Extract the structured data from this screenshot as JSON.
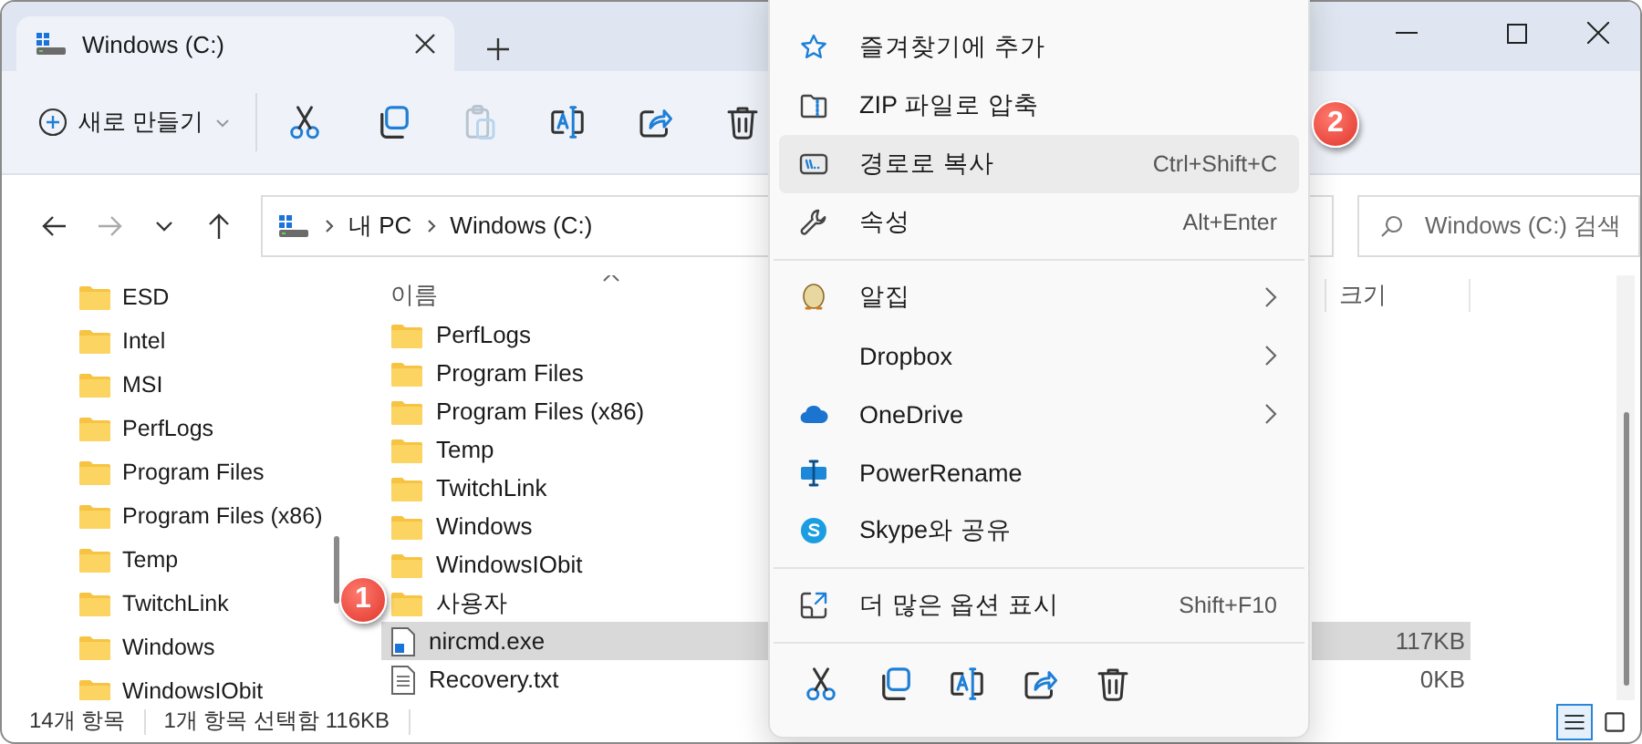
{
  "window": {
    "tab_title": "Windows (C:)"
  },
  "toolbar": {
    "new_button": "새로 만들기",
    "actions": [
      {
        "kind": "cut",
        "disabled": false
      },
      {
        "kind": "copy",
        "disabled": false
      },
      {
        "kind": "paste",
        "disabled": true
      },
      {
        "kind": "rename",
        "disabled": false
      },
      {
        "kind": "share",
        "disabled": false
      },
      {
        "kind": "delete",
        "disabled": false
      }
    ]
  },
  "address_bar": {
    "path": [
      "내 PC",
      "Windows (C:)"
    ]
  },
  "search": {
    "placeholder": "Windows (C:) 검색"
  },
  "nav_pane": {
    "items": [
      "ESD",
      "Intel",
      "MSI",
      "PerfLogs",
      "Program Files",
      "Program Files (x86)",
      "Temp",
      "TwitchLink",
      "Windows",
      "WindowsIObit"
    ]
  },
  "file_list": {
    "columns": [
      "이름",
      "크기"
    ],
    "rows": [
      {
        "name": "PerfLogs",
        "kind": "folder",
        "selected": false
      },
      {
        "name": "Program Files",
        "kind": "folder",
        "selected": false
      },
      {
        "name": "Program Files (x86)",
        "kind": "folder",
        "selected": false
      },
      {
        "name": "Temp",
        "kind": "folder",
        "selected": false
      },
      {
        "name": "TwitchLink",
        "kind": "folder",
        "selected": false
      },
      {
        "name": "Windows",
        "kind": "folder",
        "selected": false
      },
      {
        "name": "WindowsIObit",
        "kind": "folder",
        "selected": false
      },
      {
        "name": "사용자",
        "kind": "folder",
        "selected": false
      },
      {
        "name": "nircmd.exe",
        "kind": "exe",
        "size": "117KB",
        "selected": true
      },
      {
        "name": "Recovery.txt",
        "kind": "text",
        "size": "0KB",
        "selected": false
      }
    ]
  },
  "status_bar": {
    "item_count": "14개 항목",
    "selection": "1개 항목 선택함 116KB"
  },
  "view_buttons": [
    {
      "kind": "details",
      "selected": true
    },
    {
      "kind": "tiles",
      "selected": false
    }
  ],
  "context_menu": {
    "groups": [
      [
        {
          "label": "즐겨찾기에 추가",
          "submenu": false,
          "selected": false
        },
        {
          "label": "ZIP 파일로 압축",
          "submenu": false,
          "selected": false
        },
        {
          "label": "경로로 복사",
          "shortcut": "Ctrl+Shift+C",
          "submenu": false,
          "selected": true
        },
        {
          "label": "속성",
          "shortcut": "Alt+Enter",
          "submenu": false,
          "selected": false
        }
      ],
      [
        {
          "label": "알집",
          "submenu": true,
          "selected": false
        },
        {
          "label": "Dropbox",
          "submenu": true,
          "selected": false
        },
        {
          "label": "OneDrive",
          "submenu": true,
          "selected": false
        },
        {
          "label": "PowerRename",
          "submenu": false,
          "selected": false
        },
        {
          "label": "Skype와 공유",
          "submenu": false,
          "selected": false
        }
      ],
      [
        {
          "label": "더 많은 옵션 표시",
          "shortcut": "Shift+F10",
          "submenu": false,
          "selected": false
        }
      ]
    ],
    "quick_actions": [
      {
        "kind": "cut"
      },
      {
        "kind": "copy"
      },
      {
        "kind": "rename"
      },
      {
        "kind": "share"
      },
      {
        "kind": "delete"
      }
    ]
  },
  "callouts": [
    {
      "label": "1"
    },
    {
      "label": "2"
    }
  ]
}
